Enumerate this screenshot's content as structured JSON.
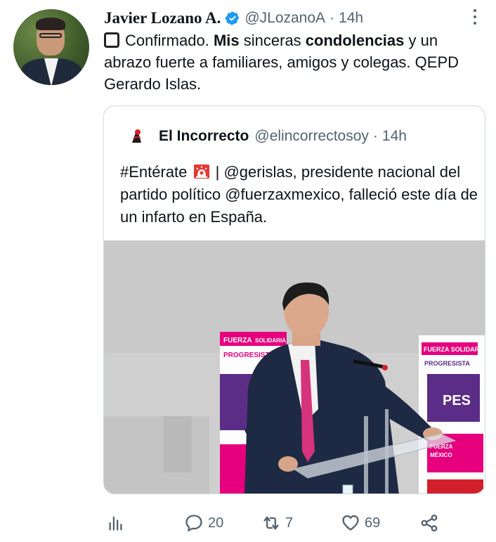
{
  "tweet": {
    "author_name": "Javier Lozano A.",
    "handle": "@JLozanoA",
    "separator": "·",
    "time": "14h",
    "text": {
      "emoji": "square-button-icon",
      "p1": "Confirmado. ",
      "b1": "Mis",
      "p2": " sinceras ",
      "b2": "condolencias",
      "p3": " y un abrazo fuerte a familiares, amigos y colegas. QEPD Gerardo Islas."
    }
  },
  "quote": {
    "author_name": "El Incorrecto",
    "handle": "@elincorrectosoy",
    "separator": "·",
    "time": "14h",
    "text_before": "#Entérate",
    "text_after": " | @gerislas, presidente nacional del partido político @fuerzaxmexico, falleció este día de un infarto en España.",
    "emoji": "rotating-light-icon",
    "photo": {
      "banner_left_line1": "FUERZA",
      "banner_left_line1b": "SOLIDARIA",
      "banner_left_line2": "PROGRESISTA",
      "banner_right_line1": "FUERZA SOLIDARIA",
      "banner_right_line2": "PROGRESISTA",
      "banner_right_logo": "PES",
      "banner_right_small1": "FUERZA",
      "banner_right_small2": "MÉXICO"
    }
  },
  "actions": {
    "analytics_label": "",
    "replies": "20",
    "retweets": "7",
    "likes": "69",
    "share_label": ""
  },
  "colors": {
    "text_primary": "#0f1419",
    "text_secondary": "#536471",
    "verified_blue": "#1d9bf0",
    "border": "#cfd9de",
    "banner_pink": "#e6007e",
    "banner_purple": "#5b2d86"
  }
}
